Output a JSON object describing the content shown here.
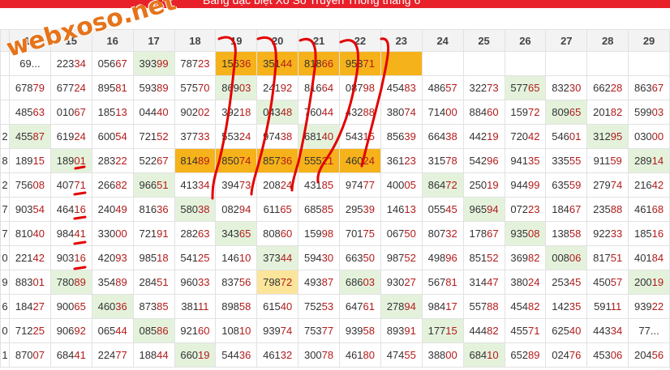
{
  "header": {
    "title": "Bảng đặc biệt Xổ Số Truyền Thống tháng 6"
  },
  "watermark": "webxoso.net",
  "columns": [
    "",
    "14",
    "15",
    "16",
    "17",
    "18",
    "19",
    "20",
    "21",
    "22",
    "23",
    "24",
    "25",
    "26",
    "27",
    "28",
    "29"
  ],
  "rows": [
    [
      "",
      "69...",
      "22334",
      "05667",
      "39399",
      "78723",
      "15636",
      "35144",
      "81866",
      "95371",
      "",
      "",
      "",
      "",
      "",
      "",
      ""
    ],
    [
      "",
      "67879",
      "67724",
      "89581",
      "59389",
      "57570",
      "86903",
      "24192",
      "81664",
      "08798",
      "45483",
      "48657",
      "32273",
      "57765",
      "83230",
      "66228",
      "86367"
    ],
    [
      "",
      "48563",
      "01067",
      "18513",
      "04440",
      "90202",
      "39218",
      "04348",
      "76044",
      "43288",
      "38074",
      "71400",
      "88460",
      "15972",
      "80965",
      "20182",
      "59903"
    ],
    [
      "2",
      "45587",
      "61924",
      "60054",
      "72152",
      "37733",
      "55324",
      "97438",
      "68140",
      "54315",
      "85639",
      "66438",
      "44219",
      "72042",
      "54601",
      "31295",
      "03000"
    ],
    [
      "8",
      "18915",
      "18901",
      "28322",
      "52267",
      "81489",
      "85074",
      "85736",
      "55521",
      "46024",
      "36123",
      "31578",
      "54296",
      "94135",
      "33555",
      "91159",
      "28914"
    ],
    [
      "2",
      "75608",
      "40771",
      "26682",
      "96651",
      "41334",
      "39473",
      "20824",
      "43185",
      "97477",
      "40005",
      "86472",
      "25019",
      "94499",
      "63559",
      "27974",
      "21642"
    ],
    [
      "7",
      "90354",
      "46416",
      "24049",
      "81636",
      "58038",
      "08294",
      "61165",
      "68585",
      "29539",
      "14613",
      "05545",
      "96594",
      "07223",
      "18467",
      "23588",
      "46168"
    ],
    [
      "7",
      "81040",
      "98441",
      "33000",
      "72191",
      "28263",
      "34365",
      "80860",
      "15998",
      "70175",
      "06750",
      "80732",
      "17867",
      "93508",
      "13858",
      "92233",
      "18516"
    ],
    [
      "0",
      "22142",
      "90316",
      "42093",
      "98518",
      "54125",
      "14610",
      "37344",
      "59430",
      "66350",
      "98752",
      "49896",
      "85152",
      "36982",
      "00806",
      "81751",
      "40184"
    ],
    [
      "9",
      "88301",
      "78089",
      "35489",
      "28451",
      "96033",
      "83756",
      "79872",
      "49387",
      "68603",
      "93027",
      "56781",
      "31447",
      "38024",
      "25345",
      "45057",
      "20019"
    ],
    [
      "6",
      "18427",
      "90065",
      "46036",
      "87385",
      "38111",
      "89858",
      "61540",
      "75253",
      "64761",
      "27894",
      "98417",
      "55788",
      "45482",
      "14235",
      "59111",
      "93922"
    ],
    [
      "0",
      "71225",
      "90692",
      "06544",
      "08586",
      "92160",
      "10810",
      "93974",
      "75377",
      "93958",
      "89391",
      "17715",
      "44482",
      "45571",
      "62540",
      "44334",
      "77..."
    ],
    [
      "1",
      "87007",
      "68441",
      "22477",
      "18844",
      "66019",
      "54436",
      "46132",
      "30078",
      "46180",
      "47455",
      "38800",
      "68410",
      "65289",
      "02476",
      "45306",
      "20456"
    ]
  ],
  "highlights": {
    "gold": [
      "0-6",
      "0-7",
      "0-8",
      "0-9",
      "0-10",
      "4-5",
      "4-6",
      "4-7",
      "4-8",
      "4-9"
    ],
    "pale": [
      "9-7"
    ],
    "green": [
      "0-4",
      "0-11",
      "1-6",
      "1-13",
      "2-7",
      "2-14",
      "3-1",
      "3-8",
      "3-15",
      "4-2",
      "4-16",
      "5-4",
      "5-11",
      "6-5",
      "6-12",
      "7-6",
      "7-13",
      "8-7",
      "8-14",
      "9-2",
      "9-9",
      "9-16",
      "10-3",
      "10-10",
      "11-4",
      "11-11",
      "12-5",
      "12-12"
    ],
    "empty": [
      "0-11",
      "0-12",
      "0-13",
      "0-14",
      "0-15",
      "0-16"
    ]
  },
  "colors": {
    "header_red": "#e8202a",
    "gold": "#f6b21a",
    "green": "#e4f2dc",
    "tail_digits": "#b31b1b"
  }
}
